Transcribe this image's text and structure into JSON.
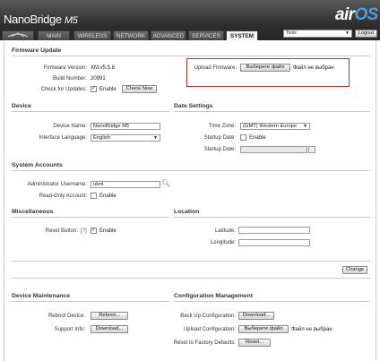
{
  "header": {
    "brand_name": "NanoBridge",
    "brand_model": "M5",
    "logo_air": "air",
    "logo_os": "OS",
    "tabs": [
      "MAIN",
      "WIRELESS",
      "NETWORK",
      "ADVANCED",
      "SERVICES",
      "SYSTEM"
    ],
    "active_tab": "SYSTEM",
    "tools_label": "Tools:",
    "logout_label": "Logout"
  },
  "firmware": {
    "title": "Firmware Update",
    "version_label": "Firmware Version:",
    "version_value": "XM.v5.5.8",
    "build_label": "Build Number:",
    "build_value": "20991",
    "check_label": "Check for Updates:",
    "check_checked": true,
    "check_enable": "Enable",
    "check_now_button": "Check Now",
    "upload_label": "Upload Firmware:",
    "choose_file_button": "Выберите файл",
    "no_file_text": "Файл не выбран"
  },
  "device": {
    "title": "Device",
    "name_label": "Device Name:",
    "name_value": "NanoBridge M5",
    "lang_label": "Interface Language:",
    "lang_value": "English"
  },
  "date_settings": {
    "title": "Date Settings",
    "tz_label": "Time Zone:",
    "tz_value": "(GMT) Western Europe",
    "startup_label": "Startup Date:",
    "startup_enable": "Enable",
    "startup_checked": false,
    "startup_date_label": "Startup Date:",
    "startup_date_value": ""
  },
  "accounts": {
    "title": "System Accounts",
    "admin_label": "Administrator Username:",
    "admin_value": "ubnt",
    "readonly_label": "Read-Only Account:",
    "readonly_enable": "Enable",
    "readonly_checked": false
  },
  "misc": {
    "title": "Miscellaneous",
    "reset_label": "Reset Button:",
    "reset_help": "[?]",
    "reset_enable": "Enable",
    "reset_checked": true
  },
  "location": {
    "title": "Location",
    "lat_label": "Latitude:",
    "lat_value": "",
    "lon_label": "Longitude:",
    "lon_value": ""
  },
  "change_button": "Change",
  "maintenance": {
    "title": "Device Maintenance",
    "reboot_label": "Reboot Device:",
    "reboot_button": "Reboot...",
    "support_label": "Support Info:",
    "support_button": "Download..."
  },
  "config": {
    "title": "Configuration Management",
    "backup_label": "Back Up Configuration:",
    "backup_button": "Download...",
    "upload_label": "Upload Configuration:",
    "upload_button": "Выберите файл",
    "upload_no_file": "Файл не выбран",
    "reset_label": "Reset to Factory Defaults:",
    "reset_button": "Reset..."
  },
  "colors": {
    "accent": "#4d9be0",
    "header_dark": "#2f2f2f",
    "highlight_box": "#c62828"
  }
}
